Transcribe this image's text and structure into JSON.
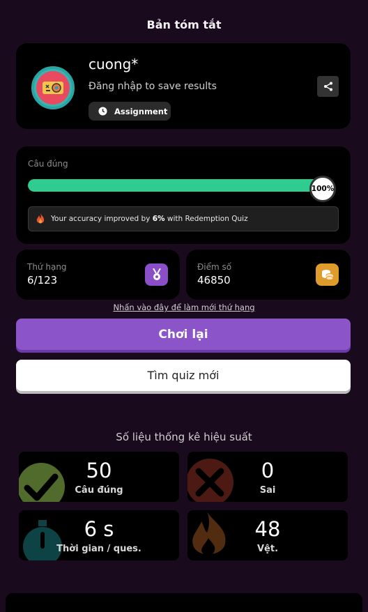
{
  "header": {
    "title": "Bản tóm tắt"
  },
  "profile": {
    "username": "cuong*",
    "login_hint": "Đăng nhập to save results",
    "assignment_label": "Assignment"
  },
  "accuracy": {
    "label": "Câu đúng",
    "percent_value": 100,
    "percent_text": "100%",
    "improve_prefix": "Your accuracy improved by",
    "improve_value": "6%",
    "improve_suffix": "with Redemption Quiz"
  },
  "rank": {
    "label": "Thứ hạng",
    "value": "6/123"
  },
  "score": {
    "label": "Điểm số",
    "value": "46850"
  },
  "leaderboard_link": "Nhấn vào đây để làm mới thứ hạng",
  "buttons": {
    "play_again": "Chơi lại",
    "find_quiz": "Tìm quiz mới"
  },
  "performance": {
    "title": "Số liệu thống kê hiệu suất",
    "correct": {
      "value": "50",
      "label": "Câu đúng"
    },
    "wrong": {
      "value": "0",
      "label": "Sai"
    },
    "time": {
      "value": "6 s",
      "label": "Thời gian / ques."
    },
    "streak": {
      "value": "48",
      "label": "Vệt."
    }
  },
  "colors": {
    "background": "#1a0a1d",
    "progress": "#2ecc8f",
    "play_button": "#8b55c9",
    "rank_icon": "#8a4fc8",
    "score_icon": "#e09b2d"
  },
  "icons": {
    "avatar": "robot-avatar-icon",
    "assignment": "clock-icon",
    "share": "share-icon",
    "improve": "flame-icon",
    "rank": "medal-icon",
    "score": "coins-icon",
    "correct": "check-icon",
    "wrong": "x-icon",
    "time": "stopwatch-icon",
    "streak": "fire-icon"
  }
}
